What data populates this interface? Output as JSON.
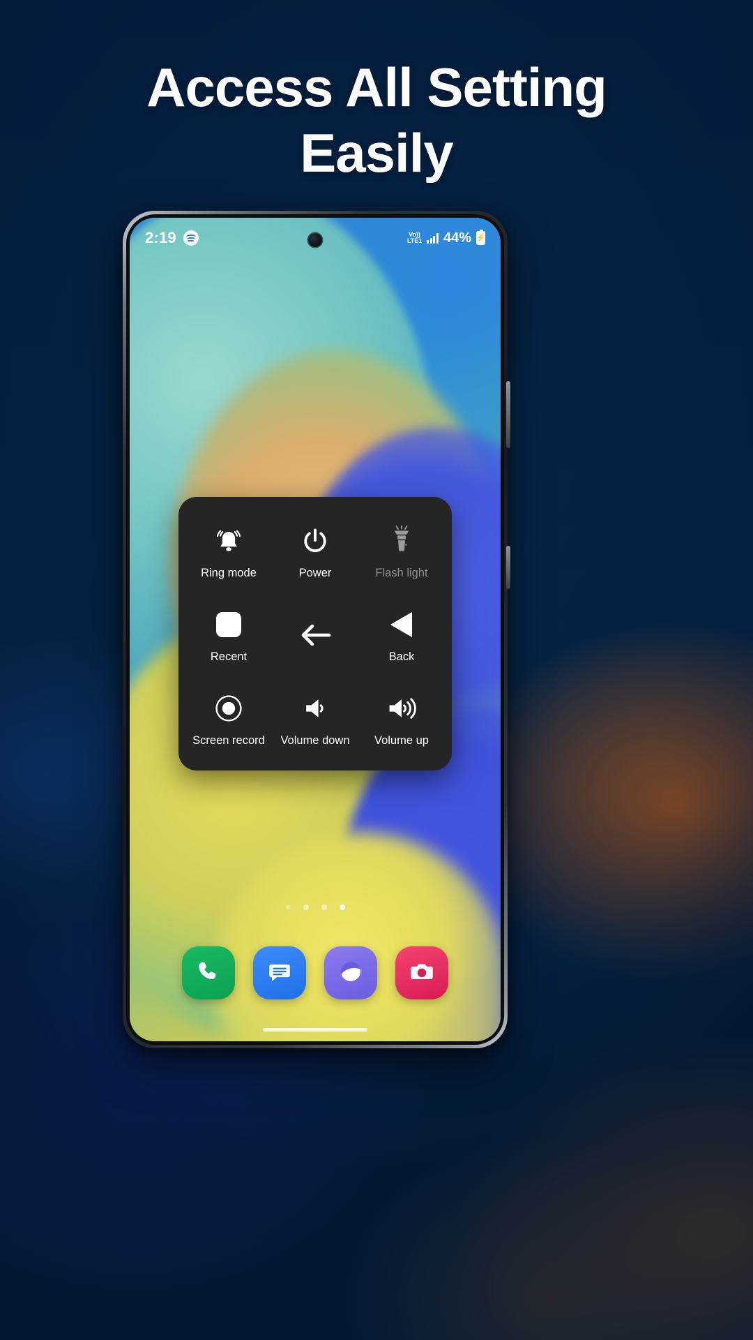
{
  "headline": {
    "line1": "Access All Setting",
    "line2": "Easily"
  },
  "colors": {
    "background_top": "#052142",
    "panel_bg": "#252525",
    "label": "#ffffff",
    "label_dimmed": "#8f8f8f",
    "dock_phone": "#0aa254",
    "dock_messages": "#1f6fe8",
    "dock_browser": "#6a5de0",
    "dock_camera": "#d81b52"
  },
  "status_bar": {
    "time": "2:19",
    "media_icon": "spotify-icon",
    "network_line1": "Vo))",
    "network_line2": "LTE1",
    "signal_icon": "signal-bars-icon",
    "battery_text": "44%",
    "battery_icon": "battery-charging-icon"
  },
  "control_panel": {
    "items": [
      {
        "label": "Ring mode",
        "icon": "bell-ring-icon",
        "dimmed": false,
        "has_label": true
      },
      {
        "label": "Power",
        "icon": "power-icon",
        "dimmed": false,
        "has_label": true
      },
      {
        "label": "Flash light",
        "icon": "flashlight-icon",
        "dimmed": true,
        "has_label": true
      },
      {
        "label": "Recent",
        "icon": "recent-square-icon",
        "dimmed": false,
        "has_label": true
      },
      {
        "label": "",
        "icon": "arrow-left-icon",
        "dimmed": false,
        "has_label": false
      },
      {
        "label": "Back",
        "icon": "back-triangle-icon",
        "dimmed": false,
        "has_label": true
      },
      {
        "label": "Screen record",
        "icon": "record-circle-icon",
        "dimmed": false,
        "has_label": true
      },
      {
        "label": "Volume down",
        "icon": "volume-down-icon",
        "dimmed": false,
        "has_label": true
      },
      {
        "label": "Volume up",
        "icon": "volume-up-icon",
        "dimmed": false,
        "has_label": true
      }
    ]
  },
  "home_screen": {
    "page_indicator": {
      "glyph": "≡",
      "total_dots": 3,
      "active_index": 2
    },
    "dock": [
      {
        "name": "Phone",
        "icon": "phone-icon"
      },
      {
        "name": "Messages",
        "icon": "message-icon"
      },
      {
        "name": "Browser",
        "icon": "browser-icon"
      },
      {
        "name": "Camera",
        "icon": "camera-icon"
      }
    ]
  }
}
